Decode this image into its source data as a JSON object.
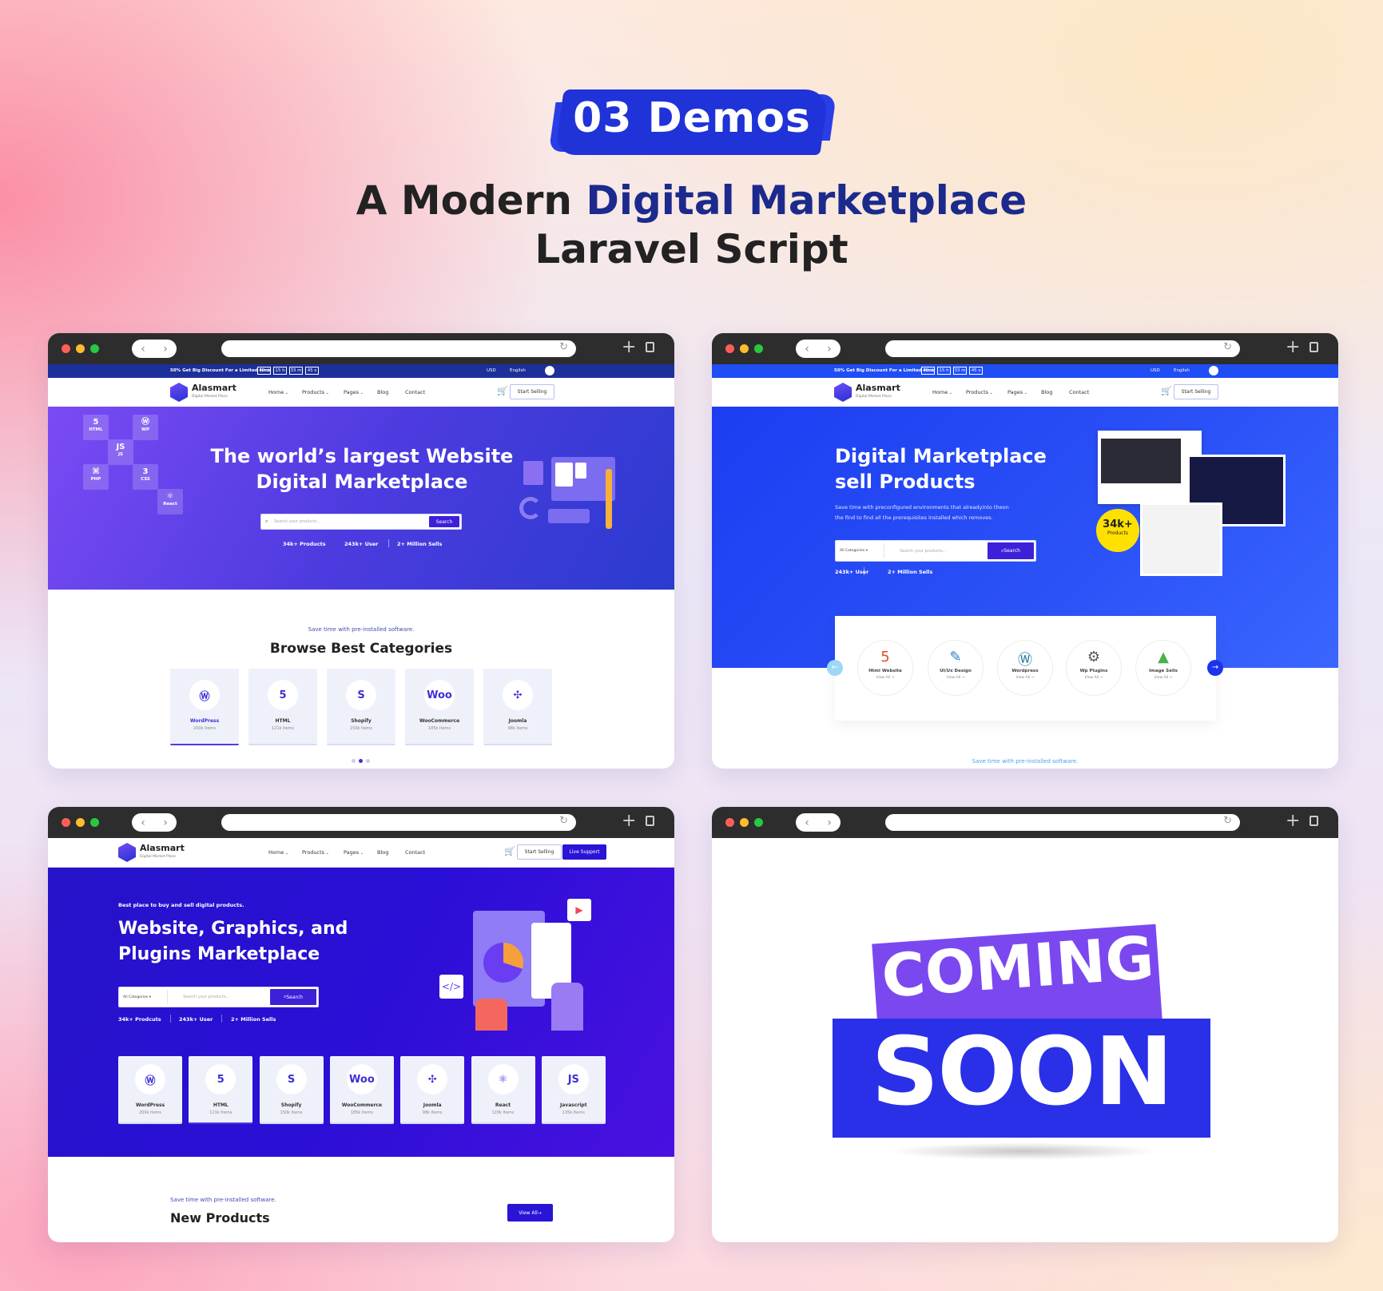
{
  "header": {
    "badge": "03 Demos",
    "title_line1_a": "A Modern ",
    "title_line1_b": "Digital Marketplace",
    "title_line2": "Laravel Script"
  },
  "colors": {
    "brand_blue": "#1b2a8c",
    "badge_blue": "#1f33d8",
    "accent_purple": "#3d21d9",
    "coming_purple": "#7b48f0",
    "soon_blue": "#2a2fe8"
  },
  "common": {
    "promo_text": "50% Get Big Discount For a Limited time",
    "timer": [
      "40 d",
      "15 h",
      "33 m",
      "45 s"
    ],
    "currency": "USD",
    "language": "English",
    "logo_name": "Alasmart",
    "logo_sub": "Digital Market Place",
    "nav": [
      "Home",
      "Products",
      "Pages",
      "Blog",
      "Contact"
    ],
    "nav_dropdown": [
      true,
      true,
      true,
      false,
      false
    ],
    "start_selling": "Start Selling",
    "live_support": "Live Support",
    "search_placeholder": "Search your products...",
    "search_button": "Search",
    "all_categories": "All Categories"
  },
  "demo1": {
    "hero_line1": "The world’s largest Website",
    "hero_line2": "Digital Marketplace",
    "tech_tiles": [
      "HTML",
      "WP",
      "JS",
      "PHP",
      "CSS",
      "React"
    ],
    "stats": [
      "34k+ Products",
      "243k+ User",
      "2+ Million Sells"
    ],
    "section_sub": "Save time with pre-installed software.",
    "section_title": "Browse Best Categories",
    "categories": [
      {
        "name": "WordPress",
        "count": "200k Items",
        "icon": "wordpress-icon",
        "active": true
      },
      {
        "name": "HTML",
        "count": "121k Items",
        "icon": "html5-icon",
        "active": false
      },
      {
        "name": "Shopify",
        "count": "150k Items",
        "icon": "shopify-icon",
        "active": false
      },
      {
        "name": "WooCommerce",
        "count": "185k Items",
        "icon": "woo-icon",
        "active": false
      },
      {
        "name": "Joomla",
        "count": "98k Items",
        "icon": "joomla-icon",
        "active": false
      }
    ],
    "carousel_page": 2,
    "carousel_pages": 3
  },
  "demo2": {
    "hero_line1": "Digital Marketplace",
    "hero_line2": "sell Products",
    "desc_line1": "Save time with preconfigured environments that alreadyinto theon",
    "desc_line2": "the find to  find all the prerequisites installed which removes.",
    "stats": [
      "243k+ User",
      "2+ Million Sells"
    ],
    "badge_value": "34k+",
    "badge_label": "Products",
    "categories": [
      {
        "name": "Html Website",
        "link": "View All →",
        "icon": "html5-icon"
      },
      {
        "name": "UI/Ux Design",
        "link": "View All →",
        "icon": "design-icon"
      },
      {
        "name": "Wordpress",
        "link": "View All →",
        "icon": "wordpress-icon"
      },
      {
        "name": "Wp Plugins",
        "link": "View All →",
        "icon": "plugin-gear-icon"
      },
      {
        "name": "Image Sells",
        "link": "View All →",
        "icon": "image-icon"
      }
    ],
    "section_sub": "Save time with pre-installed software."
  },
  "demo3": {
    "eyebrow": "Best place to buy and sell digital products.",
    "hero_line1": "Website, Graphics, and",
    "hero_line2": "Plugins Marketplace",
    "stats": [
      "34k+ Prodcuts",
      "243k+ User",
      "2+ Million Sells"
    ],
    "categories": [
      {
        "name": "WordPress",
        "count": "200k Items",
        "icon": "wordpress-icon",
        "active": false
      },
      {
        "name": "HTML",
        "count": "121k Items",
        "icon": "html5-icon",
        "active": true
      },
      {
        "name": "Shopify",
        "count": "150k Items",
        "icon": "shopify-icon",
        "active": false
      },
      {
        "name": "WooCommerce",
        "count": "185k Items",
        "icon": "woo-icon",
        "active": false
      },
      {
        "name": "Joomla",
        "count": "98k Items",
        "icon": "joomla-icon",
        "active": false
      },
      {
        "name": "React",
        "count": "120k Items",
        "icon": "react-icon",
        "active": false
      },
      {
        "name": "Javascript",
        "count": "135k Items",
        "icon": "js-icon",
        "active": false
      }
    ],
    "section_sub": "Save time with pre-installed software.",
    "section_title": "New Products",
    "view_all": "View All"
  },
  "demo4": {
    "coming": "COMING",
    "soon": "SOON"
  }
}
